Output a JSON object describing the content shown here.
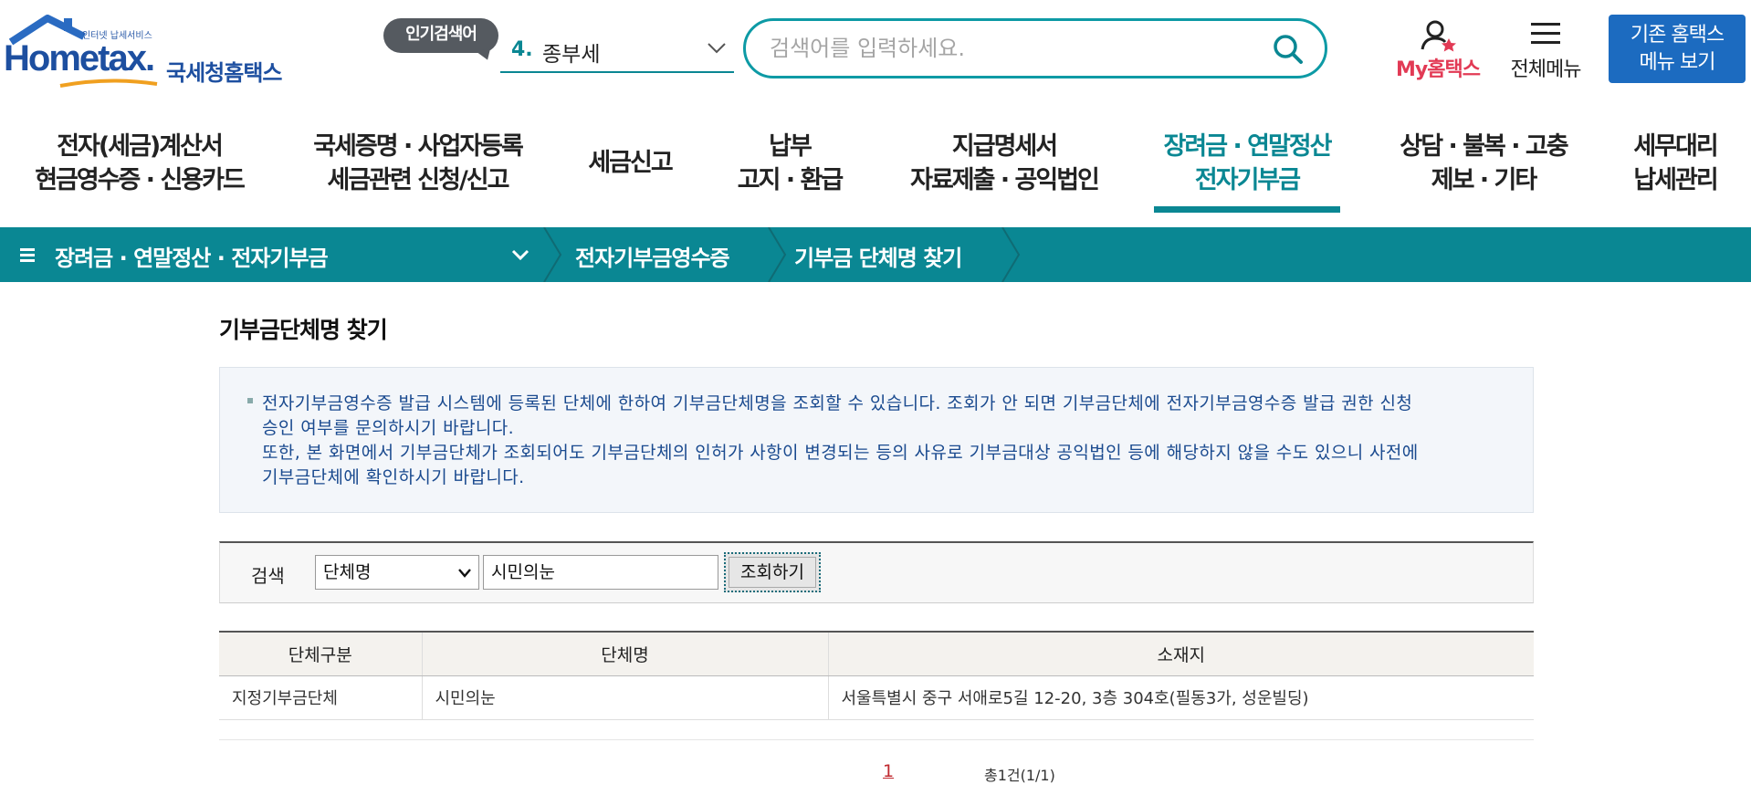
{
  "header": {
    "logo_subtitle": "인터넷 납세서비스",
    "logo_brand": "Hometax.",
    "logo_korean": "국세청홈택스",
    "popular_badge": "인기검색어",
    "popular_rank": "4.",
    "popular_keyword": "종부세",
    "search_placeholder": "검색어를 입력하세요.",
    "my_hometax": "My홈택스",
    "all_menu": "전체메뉴",
    "old_menu_line1": "기존 홈택스",
    "old_menu_line2": "메뉴 보기"
  },
  "gnb": [
    {
      "line1": "전자(세금)계산서",
      "line2": "현금영수증 · 신용카드"
    },
    {
      "line1": "국세증명 · 사업자등록",
      "line2": "세금관련 신청/신고"
    },
    {
      "line1": "세금신고",
      "line2": ""
    },
    {
      "line1": "납부",
      "line2": "고지 · 환급"
    },
    {
      "line1": "지급명세서",
      "line2": "자료제출 · 공익법인"
    },
    {
      "line1": "장려금 · 연말정산",
      "line2": "전자기부금",
      "active": true
    },
    {
      "line1": "상담 · 불복 · 고충",
      "line2": "제보 · 기타"
    },
    {
      "line1": "세무대리",
      "line2": "납세관리"
    }
  ],
  "breadcrumb": {
    "level1": "장려금 · 연말정산 · 전자기부금",
    "level2": "전자기부금영수증",
    "level3": "기부금 단체명 찾기"
  },
  "page": {
    "title": "기부금단체명 찾기",
    "notice_lines": [
      "전자기부금영수증 발급 시스템에 등록된 단체에 한하여 기부금단체명을 조회할 수 있습니다. 조회가 안 되면 기부금단체에 전자기부금영수증 발급 권한 신청",
      "승인 여부를 문의하시기 바랍니다.",
      "또한, 본 화면에서 기부금단체가 조회되어도 기부금단체의 인허가 사항이 변경되는 등의 사유로 기부금대상 공익법인 등에 해당하지 않을 수도 있으니 사전에",
      "기부금단체에 확인하시기 바랍니다."
    ]
  },
  "search": {
    "label": "검색",
    "select_value": "단체명",
    "input_value": "시민의눈",
    "button": "조회하기"
  },
  "table": {
    "headers": [
      "단체구분",
      "단체명",
      "소재지"
    ],
    "rows": [
      [
        "지정기부금단체",
        "시민의눈",
        "서울특별시 중구 서애로5길 12-20, 3층 304호(필동3가, 성운빌딩)"
      ]
    ]
  },
  "pagination": {
    "current_page": "1",
    "total": "총1건(1/1)"
  },
  "colors": {
    "teal": "#0a8793",
    "brand_blue": "#1d4fa0",
    "my_red": "#e23a55",
    "button_blue": "#1c6bc0"
  }
}
